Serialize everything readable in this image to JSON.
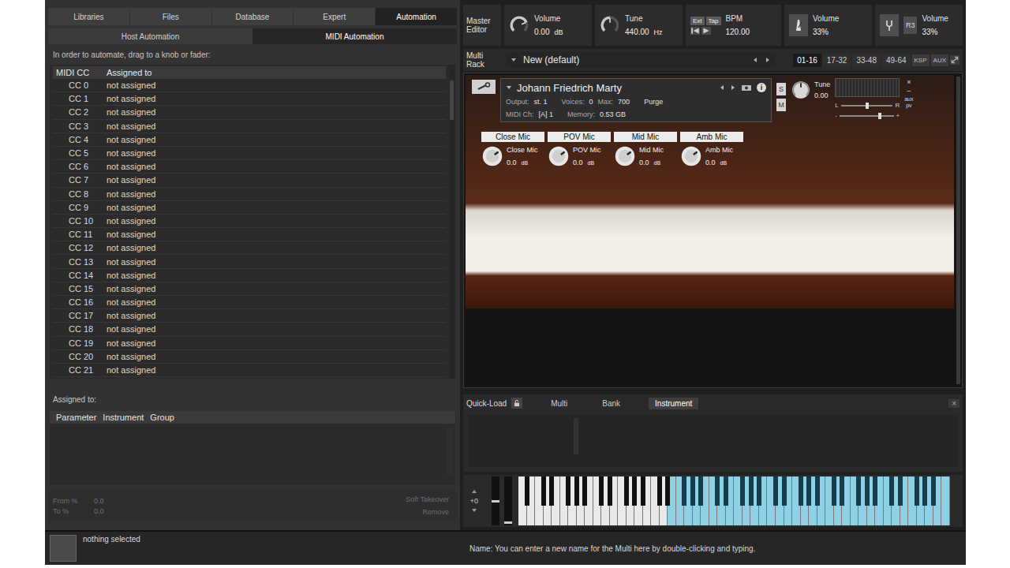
{
  "left_panel": {
    "tabs": [
      {
        "label": "Libraries",
        "selected": false
      },
      {
        "label": "Files",
        "selected": false
      },
      {
        "label": "Database",
        "selected": false
      },
      {
        "label": "Expert",
        "selected": false
      },
      {
        "label": "Automation",
        "selected": true
      }
    ],
    "subtabs": [
      {
        "label": "Host Automation",
        "selected": false
      },
      {
        "label": "MIDI Automation",
        "selected": true
      }
    ],
    "hint": "In order to automate, drag to a knob or fader:",
    "cc_table": {
      "columns": [
        "MIDI CC",
        "Assigned to"
      ],
      "rows": [
        {
          "cc": "CC 0",
          "assigned": "not assigned"
        },
        {
          "cc": "CC 1",
          "assigned": "not assigned"
        },
        {
          "cc": "CC 2",
          "assigned": "not assigned"
        },
        {
          "cc": "CC 3",
          "assigned": "not assigned"
        },
        {
          "cc": "CC 4",
          "assigned": "not assigned"
        },
        {
          "cc": "CC 5",
          "assigned": "not assigned"
        },
        {
          "cc": "CC 6",
          "assigned": "not assigned"
        },
        {
          "cc": "CC 7",
          "assigned": "not assigned"
        },
        {
          "cc": "CC 8",
          "assigned": "not assigned"
        },
        {
          "cc": "CC 9",
          "assigned": "not assigned"
        },
        {
          "cc": "CC 10",
          "assigned": "not assigned"
        },
        {
          "cc": "CC 11",
          "assigned": "not assigned"
        },
        {
          "cc": "CC 12",
          "assigned": "not assigned"
        },
        {
          "cc": "CC 13",
          "assigned": "not assigned"
        },
        {
          "cc": "CC 14",
          "assigned": "not assigned"
        },
        {
          "cc": "CC 15",
          "assigned": "not assigned"
        },
        {
          "cc": "CC 16",
          "assigned": "not assigned"
        },
        {
          "cc": "CC 17",
          "assigned": "not assigned"
        },
        {
          "cc": "CC 18",
          "assigned": "not assigned"
        },
        {
          "cc": "CC 19",
          "assigned": "not assigned"
        },
        {
          "cc": "CC 20",
          "assigned": "not assigned"
        },
        {
          "cc": "CC 21",
          "assigned": "not assigned"
        }
      ]
    },
    "assigned": {
      "title": "Assigned to:",
      "columns": [
        "Parameter",
        "Instrument",
        "Group"
      ]
    },
    "range": [
      {
        "label": "From %",
        "value": "0.0"
      },
      {
        "label": "To %",
        "value": "0.0"
      }
    ],
    "actions": [
      {
        "label": "Soft Takeover",
        "disabled": true
      },
      {
        "label": "Remove",
        "disabled": true
      }
    ]
  },
  "master": {
    "label": "Master Editor",
    "knobs": [
      {
        "label": "Volume",
        "value": "0.00",
        "unit": "dB",
        "level": 0.75
      },
      {
        "label": "Tune",
        "value": "440.00",
        "unit": "Hz",
        "level": 0.5
      }
    ],
    "sync": {
      "buttons": [
        "Ext",
        "Tap"
      ],
      "bpm_label": "BPM",
      "bpm": "120.00"
    },
    "metronome": {
      "label": "Volume",
      "value": "33%"
    },
    "tuner": {
      "mode": "R3",
      "label": "Volume",
      "value": "33%"
    }
  },
  "rack": {
    "label": "Multi Rack",
    "name": "New (default)",
    "pages": [
      {
        "label": "01-16",
        "selected": true
      },
      {
        "label": "17-32",
        "selected": false
      },
      {
        "label": "33-48",
        "selected": false
      },
      {
        "label": "49-64",
        "selected": false
      }
    ],
    "buttons": [
      "KSP",
      "AUX"
    ]
  },
  "instrument": {
    "name": "Johann Friedrich Marty",
    "info": "i",
    "output_label": "Output:",
    "output": "st. 1",
    "voices_label": "Voices:",
    "voices": "0",
    "max_label": "Max:",
    "max": "700",
    "purge": "Purge",
    "midi_label": "MIDI Ch:",
    "midi": "[A] 1",
    "memory_label": "Memory:",
    "memory": "0.53 GB",
    "solo": {
      "label": "S",
      "on": false
    },
    "mute": {
      "label": "M",
      "on": false
    },
    "tune": {
      "label": "Tune",
      "value": "0.00",
      "level": 0.5
    },
    "pan": {
      "left": "L",
      "right": "R",
      "level": 0.5
    },
    "volume": {
      "minus": "-",
      "plus": "+",
      "level": 0.75
    },
    "close": "×",
    "minimize": "–",
    "side": [
      "aux",
      "pv"
    ],
    "mics": [
      {
        "label": "Close Mic",
        "value": "0.0",
        "unit": "dB",
        "level": 0.7
      },
      {
        "label": "POV Mic",
        "value": "0.0",
        "unit": "dB",
        "level": 0.7
      },
      {
        "label": "Mid Mic",
        "value": "0.0",
        "unit": "dB",
        "level": 0.7
      },
      {
        "label": "Amb Mic",
        "value": "0.0",
        "unit": "dB",
        "level": 0.7
      }
    ]
  },
  "quick_load": {
    "label": "Quick-Load",
    "tabs": [
      {
        "label": "Multi",
        "selected": false
      },
      {
        "label": "Bank",
        "selected": false
      },
      {
        "label": "Instrument",
        "selected": true
      }
    ],
    "close": "×"
  },
  "keyboard": {
    "octave": "+0",
    "white_keys": 52,
    "mapped_from": 18
  },
  "status_bar": {
    "selection": "nothing selected",
    "info": "Name: You can enter a new name for the Multi here by double-clicking and typing."
  }
}
